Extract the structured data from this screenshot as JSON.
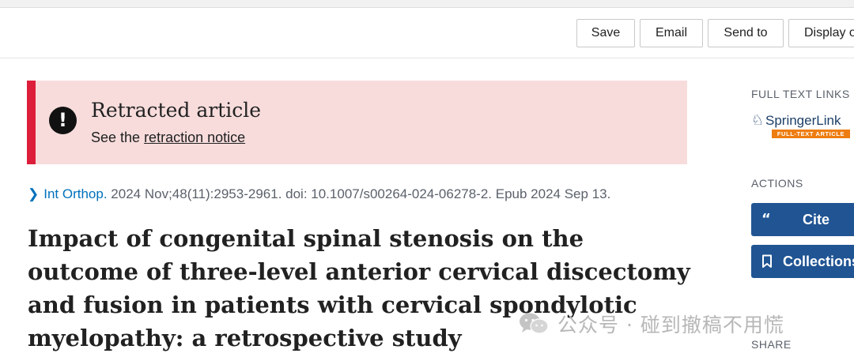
{
  "toolbar": {
    "save_label": "Save",
    "email_label": "Email",
    "send_label": "Send to",
    "display_label": "Display o"
  },
  "notice": {
    "title": "Retracted article",
    "prefix": "See the ",
    "link": "retraction notice"
  },
  "citation": {
    "journal": "Int Orthop.",
    "details": " 2024 Nov;48(11):2953-2961. doi: 10.1007/s00264-024-06278-2. Epub 2024 Sep 13."
  },
  "article": {
    "title": "Impact of congenital spinal stenosis on the outcome of three-level anterior cervical discectomy and fusion in patients with cervical spondylotic myelopathy: a retrospective study"
  },
  "sidebar": {
    "full_text_heading": "FULL TEXT LINKS",
    "springer_name": "SpringerLink",
    "springer_tag": "FULL-TEXT ARTICLE",
    "actions_heading": "ACTIONS",
    "cite_label": "Cite",
    "collections_label": "Collections",
    "share_heading": "SHARE"
  },
  "watermark": {
    "text": "公众号 · 碰到撤稿不用慌"
  },
  "colors": {
    "accent_blue": "#0071bc",
    "button_blue": "#205493",
    "retract_bg": "#f8dcdc",
    "retract_border": "#dd1e3a",
    "springer_orange": "#ee7d11"
  },
  "icons": {
    "alert": "exclamation-circle-icon",
    "chevron": "chevron-right-icon",
    "quote": "quote-icon",
    "bookmark": "bookmark-icon",
    "wechat": "wechat-icon"
  }
}
